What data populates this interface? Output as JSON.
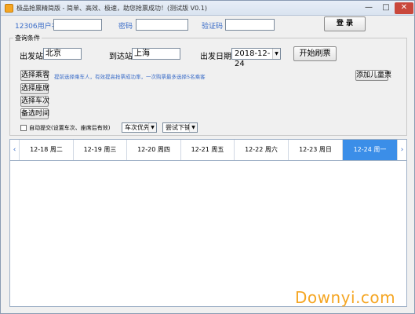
{
  "window": {
    "title": "极品抢票精简版 - 简单、高效、极速，助您抢票成功！(测试版 V0.1)",
    "controls": {
      "minimize": "—",
      "maximize": "□",
      "close": "✕"
    }
  },
  "login": {
    "username_label": "12306用户名",
    "username_value": "",
    "password_label": "密码",
    "password_value": "",
    "captcha_label": "验证码",
    "captcha_value": "",
    "login_button": "登 录"
  },
  "query": {
    "group_title": "查询条件",
    "from_label": "出发站",
    "from_value": "北京",
    "to_label": "到达站",
    "to_value": "上海",
    "date_label": "出发日期",
    "date_value": "2018-12-24",
    "refresh_button": "开始刷票"
  },
  "selectors": [
    {
      "button": "选择乘客",
      "hint": "提前选择乘车人，有效提高抢票成功率，一次购票最多选择5名乘客",
      "hint_highlight": true
    },
    {
      "button": "选择座席",
      "hint": "",
      "hint_highlight": false
    },
    {
      "button": "选择车次",
      "hint": "",
      "hint_highlight": false
    },
    {
      "button": "备选时间",
      "hint": "",
      "hint_highlight": false
    }
  ],
  "add_child_button": "添加儿童票",
  "options": {
    "auto_submit_label": "自动提交(设置车次、座席后有效)",
    "auto_submit_checked": false,
    "priority_value": "车次优先",
    "order_value": "尝试下铺"
  },
  "date_bar": {
    "prev": "‹",
    "next": "›",
    "dates": [
      {
        "label": "12-18 周二",
        "active": false
      },
      {
        "label": "12-19 周三",
        "active": false
      },
      {
        "label": "12-20 周四",
        "active": false
      },
      {
        "label": "12-21 周五",
        "active": false
      },
      {
        "label": "12-22 周六",
        "active": false
      },
      {
        "label": "12-23 周日",
        "active": false
      },
      {
        "label": "12-24 周一",
        "active": true
      }
    ]
  },
  "watermark": "Downyi.com",
  "colors": {
    "accent": "#3b8ee8",
    "label_blue": "#3a6cc8",
    "watermark_orange": "#f5a623",
    "close_red": "#c9483c"
  }
}
